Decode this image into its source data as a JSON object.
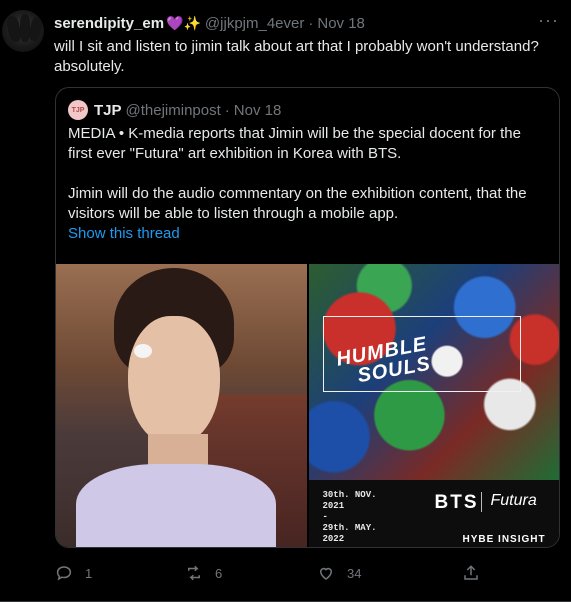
{
  "tweet": {
    "author_name": "serendipity_em",
    "author_emoji": "💜✨",
    "author_handle": "@jjkpjm_4ever",
    "separator": "·",
    "date": "Nov 18",
    "more_label": "···",
    "text": "will I sit and listen to jimin talk about art that I probably won't understand? absolutely."
  },
  "quote": {
    "avatar_text": "TJP",
    "author_name": "TJP",
    "author_handle": "@thejiminpost",
    "separator": "·",
    "date": "Nov 18",
    "line1": "MEDIA • K-media reports that Jimin will be the special docent for the first ever \"Futura\" art exhibition in Korea with BTS.",
    "line2": "Jimin will do the audio commentary on the exhibition content, that the visitors will be able to listen through a mobile app.",
    "show_thread": "Show this thread",
    "poster": {
      "title_line1": "HUMBLE",
      "title_line2": "SOULS",
      "date_start": "30th. NOV.",
      "year_start": "2021",
      "dash": "-",
      "date_end": "29th. MAY.",
      "year_end": "2022",
      "brand": "BTS",
      "signature": "Futura",
      "sponsor": "HYBE INSIGHT"
    }
  },
  "actions": {
    "reply_count": "1",
    "retweet_count": "6",
    "like_count": "34"
  },
  "icons": {
    "reply": "reply-icon",
    "retweet": "retweet-icon",
    "like": "heart-icon",
    "share": "share-icon"
  }
}
